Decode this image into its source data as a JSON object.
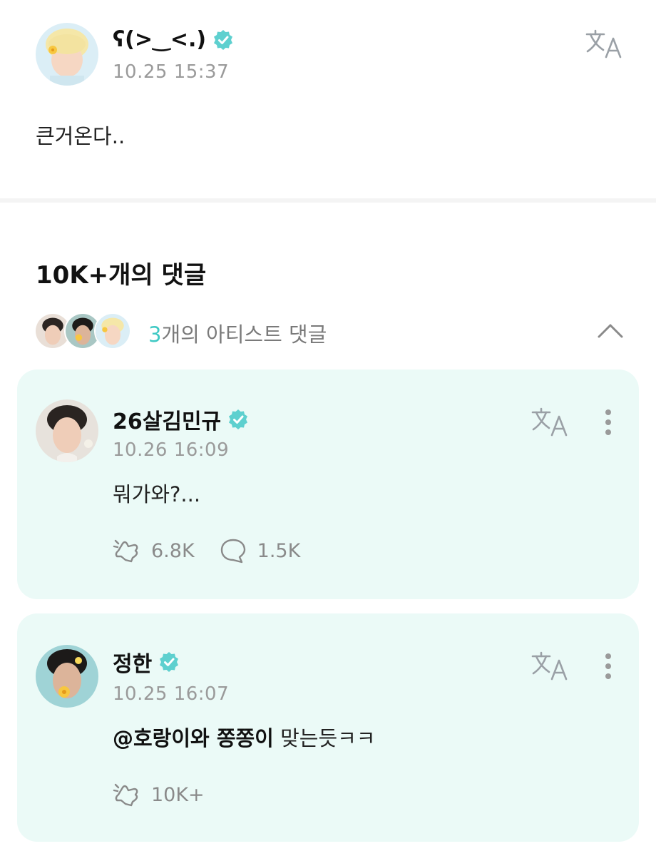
{
  "post": {
    "author": "ʕ(>‿<.)",
    "timestamp": "10.25 15:37",
    "body": "큰거온다.."
  },
  "comments_heading": "10K+개의 댓글",
  "artist_comments": {
    "count": "3",
    "label_suffix": "개의 아티스트 댓글"
  },
  "comments": [
    {
      "author": "26살김민규",
      "timestamp": "10.26 16:09",
      "mention": "",
      "body": "뭐가와?...",
      "likes": "6.8K",
      "replies": "1.5K"
    },
    {
      "author": "정한",
      "timestamp": "10.25 16:07",
      "mention": "@호랑이와 쫑쫑이",
      "body": " 맞는듯ㅋㅋ",
      "likes": "10K+"
    }
  ],
  "colors": {
    "accent": "#3fc9c4",
    "card_background": "#ebfaf7",
    "verified_badge": "#5ed0cf"
  },
  "icons": [
    "verified-badge-icon",
    "translate-icon",
    "chevron-up-icon",
    "more-vertical-icon",
    "cheer-icon",
    "comment-bubble-icon"
  ]
}
